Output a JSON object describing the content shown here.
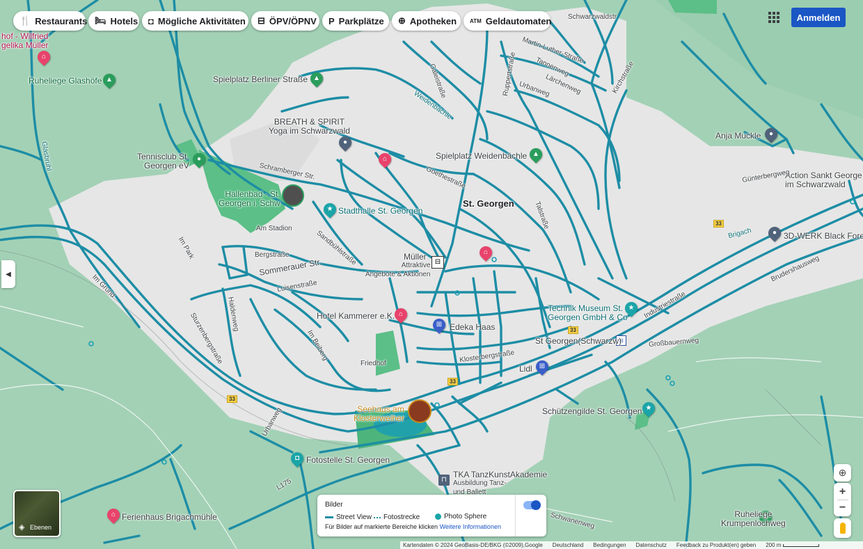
{
  "chips": [
    {
      "label": "Restaurants",
      "icon": "fork-knife-icon",
      "glyph": "🍴"
    },
    {
      "label": "Hotels",
      "icon": "bed-icon",
      "glyph": "🛏"
    },
    {
      "label": "Mögliche Aktivitäten",
      "icon": "camera-icon",
      "glyph": "◘"
    },
    {
      "label": "ÖPV/ÖPNV",
      "icon": "transit-icon",
      "glyph": "⊟"
    },
    {
      "label": "Parkplätze",
      "icon": "parking-icon",
      "glyph": "P"
    },
    {
      "label": "Apotheken",
      "icon": "pharmacy-icon",
      "glyph": "⊕"
    },
    {
      "label": "Geldautomaten",
      "icon": "atm-icon",
      "glyph": "ATM"
    }
  ],
  "header": {
    "signin": "Anmelden",
    "apps_icon": "apps-grid-icon"
  },
  "places": [
    {
      "id": "wilfried",
      "lines": [
        "hof - Wilfried",
        "gelika Müller"
      ],
      "color": "pink"
    },
    {
      "id": "glashoefe",
      "lines": [
        "Ruheliege Glashöfe"
      ],
      "color": "green"
    },
    {
      "id": "spielplatz-berliner",
      "lines": [
        "Spielplatz Berliner Straße"
      ],
      "color": "green"
    },
    {
      "id": "breath",
      "lines": [
        "BREATH & SPIRIT",
        "Yoga im Schwarzwald"
      ],
      "color": "slate"
    },
    {
      "id": "tennisclub",
      "lines": [
        "Tennisclub St.",
        "Georgen eV"
      ],
      "color": "green"
    },
    {
      "id": "hallenbad",
      "lines": [
        "Hallenbad - St.",
        "Georgen i. Schw"
      ],
      "color": "green"
    },
    {
      "id": "stadthalle",
      "lines": [
        "Stadthalle St. Georgen"
      ],
      "color": "teal"
    },
    {
      "id": "spielplatz-weiden",
      "lines": [
        "Spielplatz Weidenbächle"
      ],
      "color": "green"
    },
    {
      "id": "st-georgen",
      "lines": [
        "St. Georgen"
      ],
      "color": "bold"
    },
    {
      "id": "anja",
      "lines": [
        "Anja Muckle"
      ],
      "color": "slate"
    },
    {
      "id": "action",
      "lines": [
        "Action Sankt George",
        "im Schwarzwald"
      ],
      "color": "slate"
    },
    {
      "id": "3dwerk",
      "lines": [
        "3D-WERK Black Fores"
      ],
      "color": "slate"
    },
    {
      "id": "mueller",
      "lines": [
        "Müller"
      ],
      "color": "slate"
    },
    {
      "id": "mueller-sub",
      "lines": [
        "Attraktive",
        "Angebote & Aktionen"
      ],
      "color": "slate"
    },
    {
      "id": "hotel-kammerer",
      "lines": [
        "Hotel Kammerer e.K."
      ],
      "color": "pink"
    },
    {
      "id": "edeka",
      "lines": [
        "Edeka Haas"
      ],
      "color": "blue"
    },
    {
      "id": "technik-museum",
      "lines": [
        "Technik Museum St.",
        "Georgen GmbH & Co"
      ],
      "color": "teal"
    },
    {
      "id": "bahnhof",
      "lines": [
        "St Georgen(Schwarzw)"
      ],
      "color": "slate"
    },
    {
      "id": "lidl",
      "lines": [
        "Lidl"
      ],
      "color": "blue"
    },
    {
      "id": "seehaus",
      "lines": [
        "Seehaus am",
        "Klosterweiher"
      ],
      "color": "orange"
    },
    {
      "id": "schuetzengilde",
      "lines": [
        "Schützengilde St. Georgen"
      ],
      "color": "teal"
    },
    {
      "id": "fotostelle",
      "lines": [
        "Fotostelle St. Georgen"
      ],
      "color": "teal"
    },
    {
      "id": "tka",
      "lines": [
        "TKA TanzKunstAkademie"
      ],
      "color": "slate"
    },
    {
      "id": "tka-sub",
      "lines": [
        "Ausbildung Tanz-",
        "und Ballett"
      ],
      "color": "slate"
    },
    {
      "id": "ruheliege-krumpen",
      "lines": [
        "Ruheliege",
        "Krumpenlochweg"
      ],
      "color": "green"
    },
    {
      "id": "ferienhaus",
      "lines": [
        "Ferienhaus Brigachmühle"
      ],
      "color": "pink"
    }
  ],
  "streets": [
    "Schwarzwaldstr",
    "Martin-Luther-Straße",
    "Tannenweg",
    "Lärchenweg",
    "Urbanweg",
    "Kirchstraße",
    "Galeistraße",
    "Weidenbächle",
    "Ruppertstraße",
    "Schramberger Str.",
    "Goethestraße",
    "Talstraße",
    "Günterbergweg",
    "Brigach",
    "Im Park",
    "Bergstraße",
    "Sommerauer Str.",
    "Luisenstraße",
    "Sandbühlstraße",
    "Haldenweg",
    "Im Grund",
    "Sturzenbergstraße",
    "Im Beiberg",
    "Friedhof",
    "Klosterbergstraße",
    "Industriestraße",
    "Brudershausweg",
    "Großbauernweg",
    "Schwanenweg",
    "L175",
    "Urbanweg",
    "Am Stadion",
    "Glasbrühl"
  ],
  "road_numbers": [
    "33",
    "33",
    "33",
    "33"
  ],
  "layers": {
    "label": "Ebenen",
    "icon": "layers-icon"
  },
  "legend": {
    "title": "Bilder",
    "items": [
      {
        "label": "Street View",
        "icon": "street-view-line-icon"
      },
      {
        "label": "Fotostrecke",
        "icon": "photo-path-icon"
      },
      {
        "label": "Photo Sphere",
        "icon": "photo-sphere-icon"
      }
    ],
    "hint": "Für Bilder auf markierte Bereiche klicken",
    "link": "Weitere Informationen",
    "toggle_on": true
  },
  "footer": {
    "attribution": "Kartendaten © 2024 GeoBasis-DE/BKG (©2009),Google",
    "country": "Deutschland",
    "terms": "Bedingungen",
    "privacy": "Datenschutz",
    "feedback": "Feedback zu Produkt(en) geben",
    "scale": "200 m"
  },
  "colors": {
    "water": "#1a9fb3",
    "road": "#1f8fa7",
    "land": "#e8e8e8",
    "park": "#5bbf87",
    "bg": "#9ccbb0",
    "signin": "#1a56c4"
  }
}
